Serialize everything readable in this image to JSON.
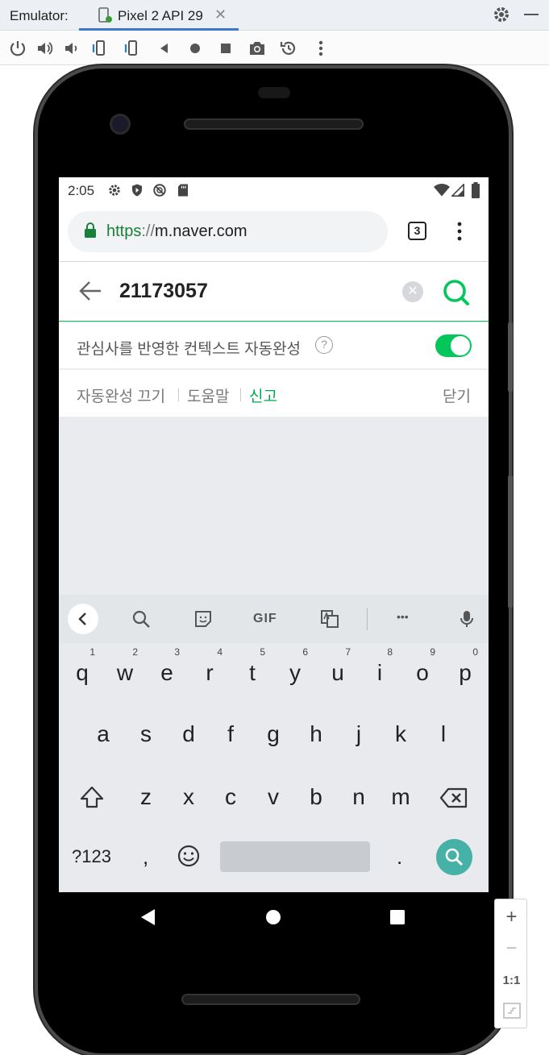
{
  "emulator": {
    "title": "Emulator:",
    "tab_label": "Pixel 2 API 29",
    "tab_close": "✕"
  },
  "status_bar": {
    "time": "2:05"
  },
  "browser": {
    "url_scheme": "https",
    "url_separator": "://",
    "url_host": "m.naver.com",
    "tab_count": "3"
  },
  "search": {
    "query": "21173057"
  },
  "context_autocomplete": {
    "label": "관심사를 반영한 컨텍스트 자동완성",
    "help": "?",
    "enabled": true
  },
  "links": {
    "turn_off": "자동완성 끄기",
    "help": "도움말",
    "report": "신고",
    "close": "닫기"
  },
  "keyboard": {
    "row1": [
      "q",
      "w",
      "e",
      "r",
      "t",
      "y",
      "u",
      "i",
      "o",
      "p"
    ],
    "row1_hints": [
      "1",
      "2",
      "3",
      "4",
      "5",
      "6",
      "7",
      "8",
      "9",
      "0"
    ],
    "row2": [
      "a",
      "s",
      "d",
      "f",
      "g",
      "h",
      "j",
      "k",
      "l"
    ],
    "row3": [
      "z",
      "x",
      "c",
      "v",
      "b",
      "n",
      "m"
    ],
    "symbols": "?123",
    "comma": ",",
    "period": ".",
    "gif": "GIF",
    "more": "•••"
  },
  "zoom": {
    "plus": "+",
    "minus": "−",
    "ratio": "1:1"
  },
  "colors": {
    "naver_green": "#03c75a",
    "accent_blue": "#3c78c8",
    "keyboard_search": "#46b1a6"
  }
}
